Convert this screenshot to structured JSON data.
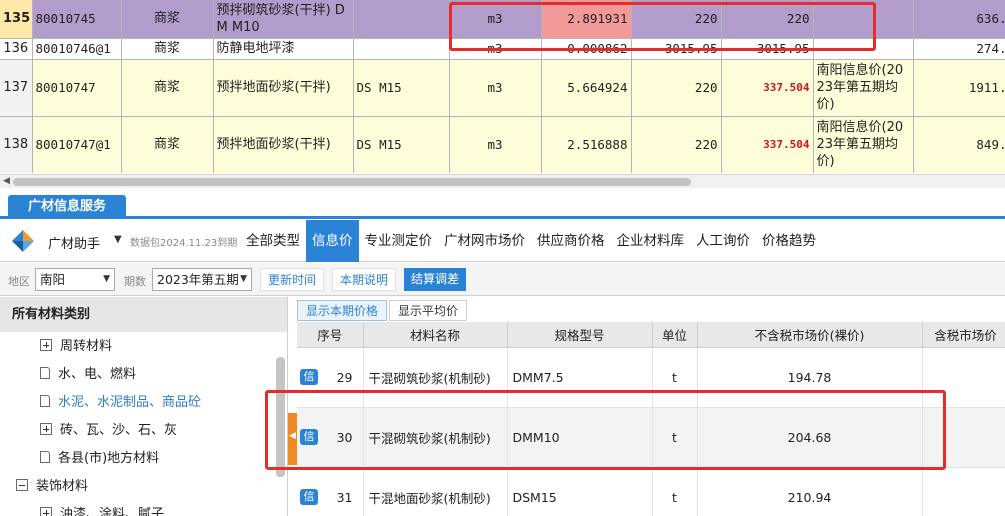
{
  "sheet": {
    "rows": [
      {
        "idx": "135",
        "code": "80010745",
        "type": "商浆",
        "name": "预拌砌筑砂浆(干拌) DM M10",
        "spec": "",
        "unit": "m3",
        "qty": "2.891931",
        "p1": "220",
        "p2": "220",
        "src": "",
        "amt": "636."
      },
      {
        "idx": "136",
        "code": "80010746@1",
        "type": "商浆",
        "name": "防静电地坪漆",
        "spec": "",
        "unit": "m3",
        "qty": "0.000862",
        "p1": "3015.95",
        "p2": "3015.95",
        "src": "",
        "amt": "274."
      },
      {
        "idx": "137",
        "code": "80010747",
        "type": "商浆",
        "name": "预拌地面砂浆(干拌)",
        "spec": "DS M15",
        "unit": "m3",
        "qty": "5.664924",
        "p1": "220",
        "p2": "337.504",
        "src": "南阳信息价(2023年第五期均价)",
        "amt": "1911."
      },
      {
        "idx": "138",
        "code": "80010747@1",
        "type": "商浆",
        "name": "预拌地面砂浆(干拌)",
        "spec": "DS M15",
        "unit": "m3",
        "qty": "2.516888",
        "p1": "220",
        "p2": "337.504",
        "src": "南阳信息价(2023年第五期均价)",
        "amt": "849."
      }
    ]
  },
  "panel": {
    "tab_label": "广材信息服务",
    "brand": "广材助手",
    "expire_note": "数据包2024.11.23到期",
    "nav_tabs": [
      "全部类型",
      "信息价",
      "专业测定价",
      "广材网市场价",
      "供应商价格",
      "企业材料库",
      "人工询价",
      "价格趋势"
    ],
    "active_tab": "信息价"
  },
  "filters": {
    "region_label": "地区",
    "region_value": "南阳",
    "period_label": "期数",
    "period_value": "2023年第五期",
    "btn_update": "更新时间",
    "btn_note": "本期说明",
    "btn_settle": "结算调差"
  },
  "tree": {
    "header": "所有材料类别",
    "items": [
      {
        "label": "周转材料",
        "icon": "plus",
        "depth": 1
      },
      {
        "label": "水、电、燃料",
        "icon": "doc",
        "depth": 1
      },
      {
        "label": "水泥、水泥制品、商品砼",
        "icon": "doc",
        "depth": 1
      },
      {
        "label": "砖、瓦、沙、石、灰",
        "icon": "plus",
        "depth": 1
      },
      {
        "label": "各县(市)地方材料",
        "icon": "doc",
        "depth": 1
      },
      {
        "label": "装饰材料",
        "icon": "minus",
        "depth": 0
      },
      {
        "label": "油漆、涂料、腻子",
        "icon": "plus",
        "depth": 1
      }
    ]
  },
  "price": {
    "subtab_current": "显示本期价格",
    "subtab_avg": "显示平均价",
    "columns": [
      "序号",
      "材料名称",
      "规格型号",
      "单位",
      "不含税市场价(裸价)",
      "含税市场价"
    ],
    "badge": "信",
    "rows": [
      {
        "seq": "29",
        "name": "干混砌筑砂浆(机制砂)",
        "spec": "DMM7.5",
        "unit": "t",
        "price": "194.78",
        "taxprice": ""
      },
      {
        "seq": "30",
        "name": "干混砌筑砂浆(机制砂)",
        "spec": "DMM10",
        "unit": "t",
        "price": "204.68",
        "taxprice": ""
      },
      {
        "seq": "31",
        "name": "干混地面砂浆(机制砂)",
        "spec": "DSM15",
        "unit": "t",
        "price": "210.94",
        "taxprice": ""
      }
    ]
  },
  "colors": {
    "accent": "#2b83d6",
    "selected_row": "#b29ccb",
    "highlight_cell": "#f29a9a",
    "annotation": "#e52b2b",
    "splitter": "#f08a24"
  }
}
